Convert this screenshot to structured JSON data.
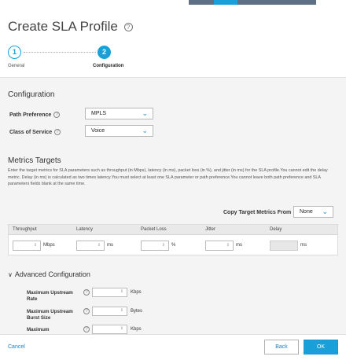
{
  "dialog": {
    "title": "Create SLA Profile"
  },
  "steps": [
    {
      "number": "1",
      "label": "General"
    },
    {
      "number": "2",
      "label": "Configuration"
    }
  ],
  "configuration": {
    "heading": "Configuration",
    "path_preference": {
      "label": "Path Preference",
      "value": "MPLS"
    },
    "class_of_service": {
      "label": "Class of Service",
      "value": "Voice"
    }
  },
  "metrics": {
    "heading": "Metrics Targets",
    "description": "Enter the target metrics for SLA parameters such as throughput (in Mbps), latency (in ms), packet loss (in %), and jitter (in ms) for the SLA profile.You cannot edit the delay metric. Delay (in ms) is calculated as two times latency.You must select at least one SLA parameter or path preference.You cannot leave both path preference and SLA parameters fields blank at the same time.",
    "copy_label": "Copy Target Metrics From",
    "copy_value": "None",
    "columns": [
      "Throughput",
      "Latency",
      "Packet Loss",
      "Jitter",
      "Delay"
    ],
    "units": [
      "Mbps",
      "ms",
      "%",
      "ms",
      "ms"
    ]
  },
  "advanced": {
    "heading": "Advanced Configuration",
    "fields": [
      {
        "label": "Maximum Upstream Rate",
        "unit": "Kbps"
      },
      {
        "label": "Maximum Upstream Burst Size",
        "unit": "Bytes"
      },
      {
        "label": "Maximum",
        "unit": "Kbps"
      }
    ]
  },
  "footer": {
    "cancel": "Cancel",
    "back": "Back",
    "ok": "OK"
  },
  "colors": {
    "accent": "#1aa0d8",
    "link": "#1a7fc2"
  }
}
